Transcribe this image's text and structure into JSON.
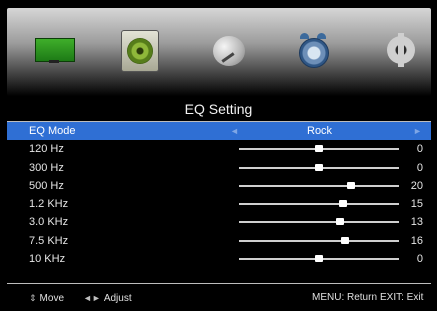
{
  "title": "EQ Setting",
  "top_icons": [
    {
      "name": "picture-tv-icon"
    },
    {
      "name": "sound-speaker-icon"
    },
    {
      "name": "channel-dish-icon"
    },
    {
      "name": "time-clock-icon"
    },
    {
      "name": "setup-gear-icon"
    }
  ],
  "eq_mode": {
    "label": "EQ Mode",
    "value": "Rock",
    "left_arrow": "◄",
    "right_arrow": "►"
  },
  "bands": [
    {
      "label": "120  Hz",
      "value": "0",
      "level": 0.5
    },
    {
      "label": "300  Hz",
      "value": "0",
      "level": 0.5
    },
    {
      "label": "500  Hz",
      "value": "20",
      "level": 0.7
    },
    {
      "label": "1.2 KHz",
      "value": "15",
      "level": 0.65
    },
    {
      "label": "3.0 KHz",
      "value": "13",
      "level": 0.63
    },
    {
      "label": "7.5 KHz",
      "value": "16",
      "level": 0.66
    },
    {
      "label": "10  KHz",
      "value": "0",
      "level": 0.5
    }
  ],
  "footer": {
    "move_icon": "⇕",
    "move": "Move",
    "adjust_icon": "◄►",
    "adjust": "Adjust",
    "return": "MENU: Return",
    "exit": "EXIT: Exit"
  },
  "colors": {
    "selection": "#2f6fd4",
    "background": "#000000",
    "text": "#e6e6e6"
  }
}
